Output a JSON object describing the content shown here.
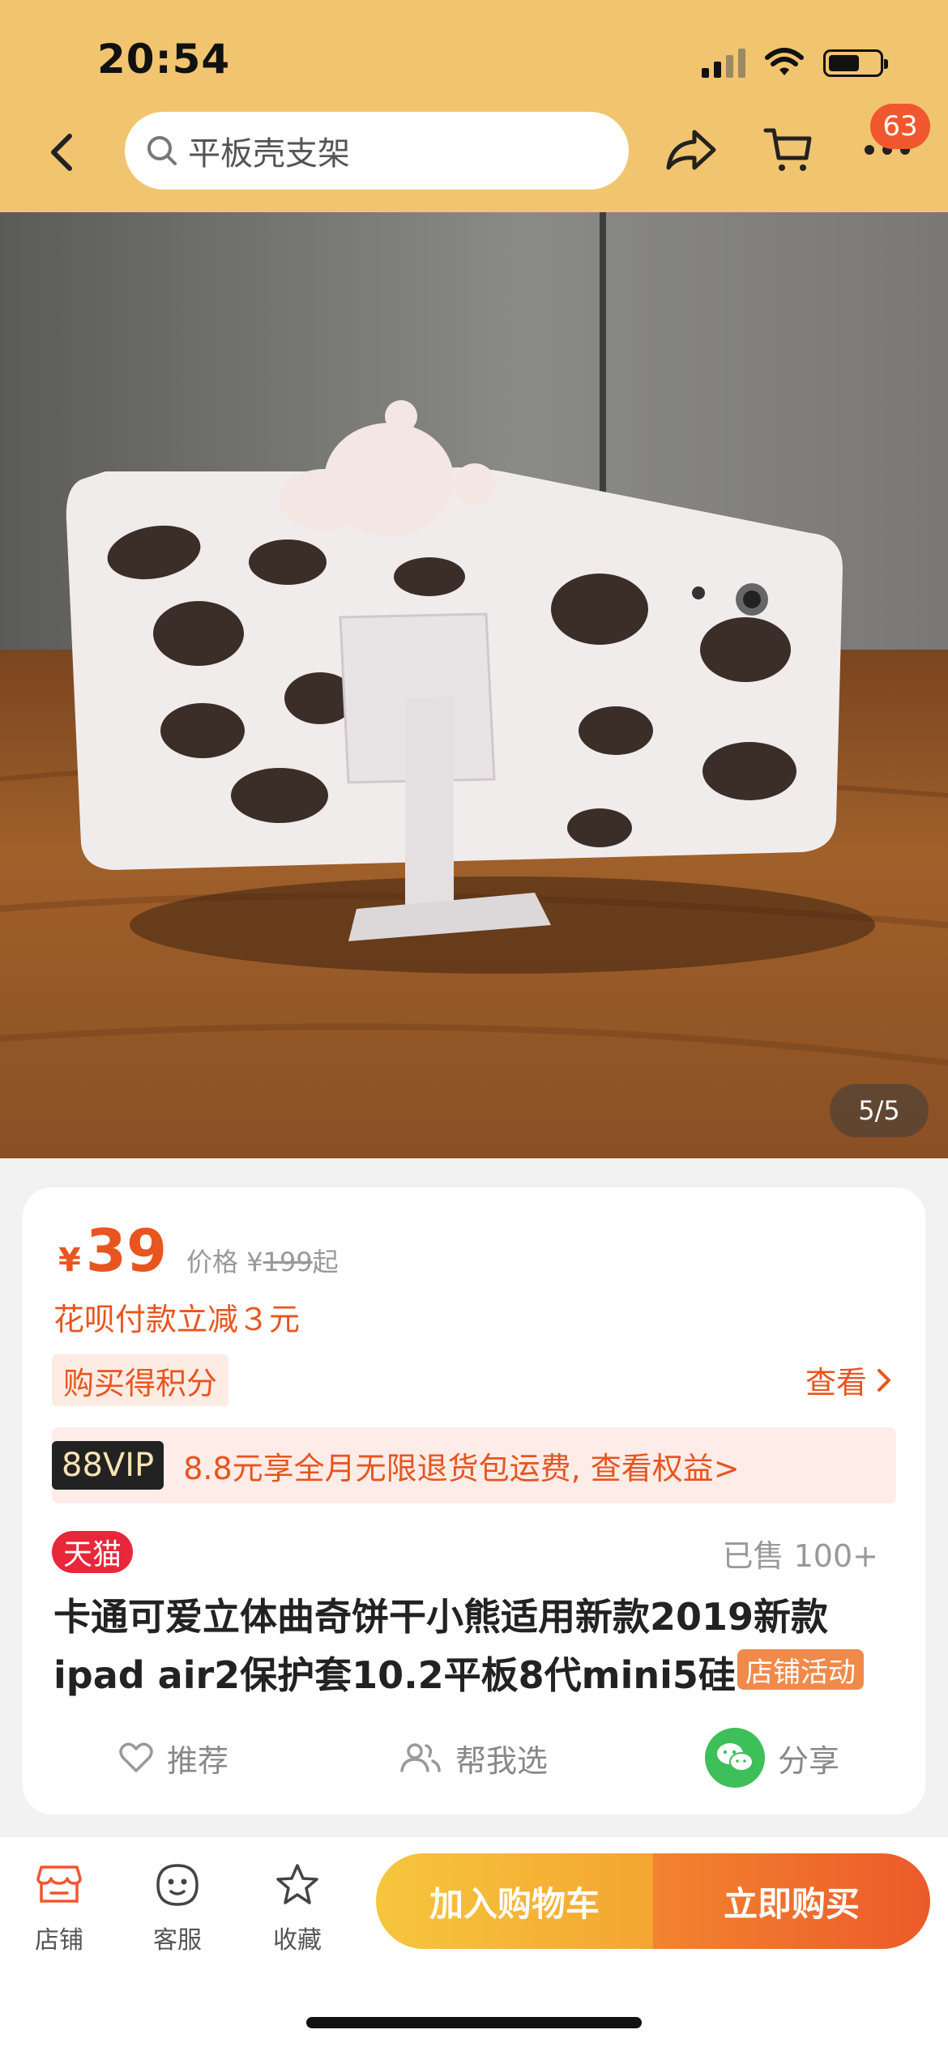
{
  "status_bar": {
    "time": "20:54"
  },
  "header": {
    "search_placeholder": "平板壳支架",
    "badge_count": "63"
  },
  "gallery": {
    "counter": "5/5"
  },
  "price": {
    "symbol": "¥",
    "value": "39",
    "orig_label": "价格 ¥",
    "orig_value": "199",
    "orig_suffix": "起"
  },
  "huabei_text": "花呗付款立减３元",
  "points_label": "购买得积分",
  "view_label": "查看",
  "vip": {
    "tag": "88VIP",
    "text": "8.8元享全月无限退货包运费, 查看权益>"
  },
  "tmall_tag": "天猫",
  "sold_text": "已售 100+",
  "title": {
    "line1": "卡通可爱立体曲奇饼干小熊适用新款2019新款",
    "line2": "ipad air2保护套10.2平板8代mini5硅..."
  },
  "shop_activity": "店铺活动",
  "actions": {
    "recommend": "推荐",
    "help_choose": "帮我选",
    "share": "分享"
  },
  "bottom_nav": {
    "shop": "店铺",
    "service": "客服",
    "favorite": "收藏",
    "add_to_cart": "加入购物车",
    "buy_now": "立即购买"
  },
  "colors": {
    "header_bg": "#f1c56f",
    "accent": "#e8551e",
    "tmall_red": "#e8273a",
    "cart_btn": "#f5b934",
    "buy_btn": "#ec5a2a"
  }
}
